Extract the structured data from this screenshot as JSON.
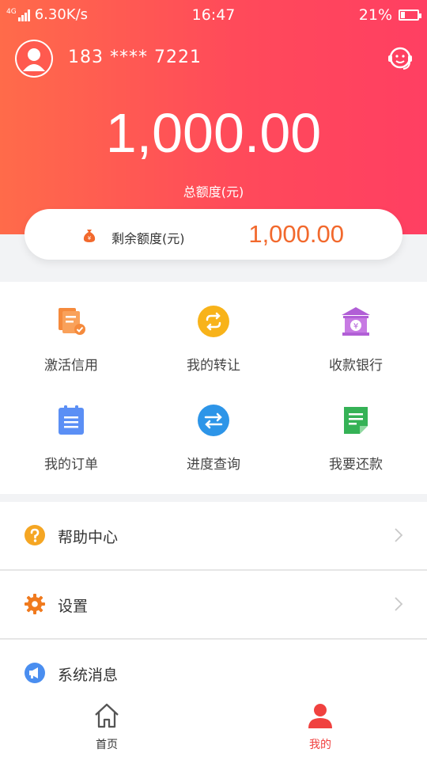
{
  "status_bar": {
    "network": "4G",
    "speed": "6.30K/s",
    "time": "16:47",
    "battery": "21%"
  },
  "header": {
    "phone": "183 **** 7221",
    "total_amount": "1,000.00",
    "total_label": "总额度(元)"
  },
  "remaining": {
    "label": "剩余额度(元)",
    "value": "1,000.00"
  },
  "features": [
    {
      "label": "激活信用",
      "icon": "activate-credit-icon"
    },
    {
      "label": "我的转让",
      "icon": "transfer-icon"
    },
    {
      "label": "收款银行",
      "icon": "bank-icon"
    },
    {
      "label": "我的订单",
      "icon": "orders-icon"
    },
    {
      "label": "进度查询",
      "icon": "progress-icon"
    },
    {
      "label": "我要还款",
      "icon": "repay-icon"
    }
  ],
  "menu": [
    {
      "label": "帮助中心",
      "icon": "help-icon"
    },
    {
      "label": "设置",
      "icon": "gear-icon"
    },
    {
      "label": "系统消息",
      "icon": "megaphone-icon"
    }
  ],
  "tabbar": [
    {
      "label": "首页",
      "icon": "home-icon",
      "active": false
    },
    {
      "label": "我的",
      "icon": "user-icon",
      "active": true
    }
  ],
  "colors": {
    "header_gradient_start": "#ff6b4a",
    "header_gradient_end": "#ff3f62",
    "accent_orange": "#f2692d",
    "tab_active": "#f0413f"
  }
}
